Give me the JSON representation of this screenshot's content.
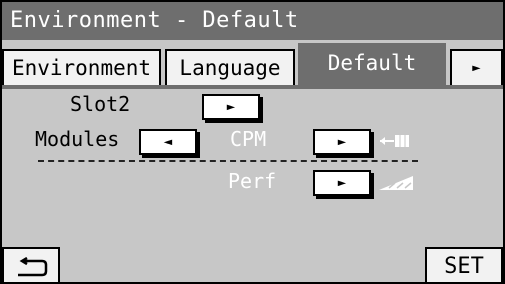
{
  "title": "Environment - Default",
  "tabs": {
    "environment": "Environment",
    "language": "Language",
    "default": "Default",
    "next_arrow": "►"
  },
  "rows": {
    "slot2": {
      "label": "Slot2",
      "arrow": "►"
    },
    "modules": {
      "label": "Modules",
      "left_arrow": "◄",
      "value": "CPM",
      "right_arrow": "►"
    },
    "perf": {
      "value": "Perf",
      "right_arrow": "►"
    }
  },
  "footer": {
    "set_label": "SET"
  },
  "icons": {
    "cpm_indicator": "arrow-into-block-icon",
    "perf_indicator": "ramp-wedge-icon",
    "back": "return-arrow-icon"
  },
  "colors": {
    "panel": "#c7c7c7",
    "header": "#6e6e6e",
    "button": "#ffffff",
    "tab": "#f2f2f2"
  }
}
